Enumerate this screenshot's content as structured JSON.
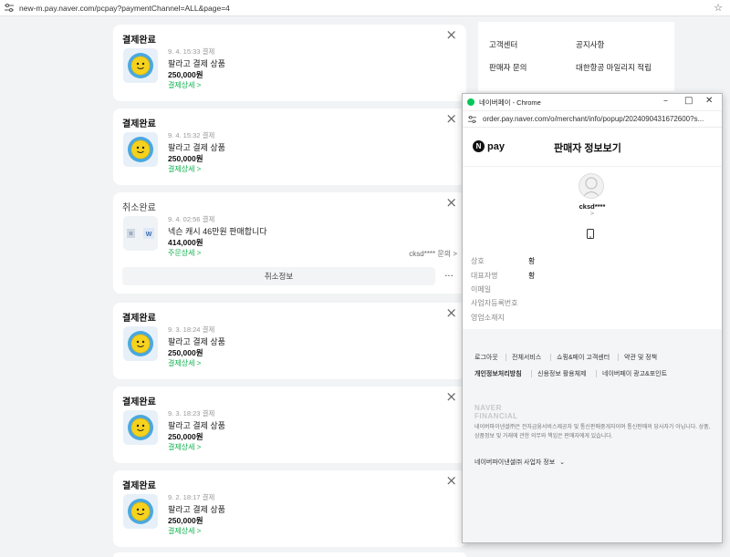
{
  "browser": {
    "url": "new-m.pay.naver.com/pcpay?paymentChannel=ALL&page=4"
  },
  "orders": [
    {
      "status": "결제완료",
      "date": "9. 4. 15:33 결제",
      "title": "팔라고 결제 상품",
      "price": "250,000원",
      "detail": "결제상세 >"
    },
    {
      "status": "결제완료",
      "date": "9. 4. 15:32 결제",
      "title": "팔라고 결제 상품",
      "price": "250,000원",
      "detail": "결제상세 >"
    },
    {
      "status": "취소완료",
      "date": "9. 4. 02:56 결제",
      "title": "넥슨 캐시 46만원 판매합니다",
      "price": "414,000원",
      "detail": "주문상세 >",
      "seller": "cksd**** 문의 >",
      "cancel_info": "취소정보",
      "more": "···"
    },
    {
      "status": "결제완료",
      "date": "9. 3. 18:24 결제",
      "title": "팔라고 결제 상품",
      "price": "250,000원",
      "detail": "결제상세 >"
    },
    {
      "status": "결제완료",
      "date": "9. 3. 18:23 결제",
      "title": "팔라고 결제 상품",
      "price": "250,000원",
      "detail": "결제상세 >"
    },
    {
      "status": "결제완료",
      "date": "9. 2. 18:17 결제",
      "title": "팔라고 결제 상품",
      "price": "250,000원",
      "detail": "결제상세 >"
    }
  ],
  "right_menu": {
    "customer_center": "고객센터",
    "notice": "공지사항",
    "seller_inquiry": "판매자 문의",
    "mileage": "대한항공 마일리지 적립"
  },
  "popup": {
    "window_title": "네이버페이 - Chrome",
    "url": "order.pay.naver.com/o/merchant/info/popup/2024090431672600?s...",
    "logo_n": "N",
    "logo_pay": "pay",
    "heading": "판매자 정보보기",
    "seller_name": "cksd****",
    "arrow": ">",
    "info": [
      {
        "label": "상호",
        "value": "황"
      },
      {
        "label": "대표자명",
        "value": "황"
      },
      {
        "label": "이메일",
        "value": ""
      },
      {
        "label": "사업자등록번호",
        "value": ""
      },
      {
        "label": "영업소재지",
        "value": ""
      }
    ],
    "footer": {
      "links_row1": [
        "로그아웃",
        "전체서비스",
        "쇼핑&페이 고객센터",
        "약관 및 정책"
      ],
      "links_row2": [
        "개인정보처리방침",
        "신용정보 활용체제",
        "네이버페이 광고&포인트"
      ],
      "logo_line1": "NAVER",
      "logo_line2": "FINANCIAL",
      "desc": "네이버파이낸셜㈜은 전자금융서비스제공자 및 통신판매중개자이며 통신판매의 당사자가 아닙니다. 상품, 상품정보 및 거래에 관한 의무와 책임은 판매자에게 있습니다.",
      "biz_info": "네이버파이낸셜㈜ 사업자 정보"
    }
  },
  "colors": {
    "accent_green": "#10b24e",
    "naver_green": "#03c75a",
    "page_bg": "#f2f3f5"
  }
}
